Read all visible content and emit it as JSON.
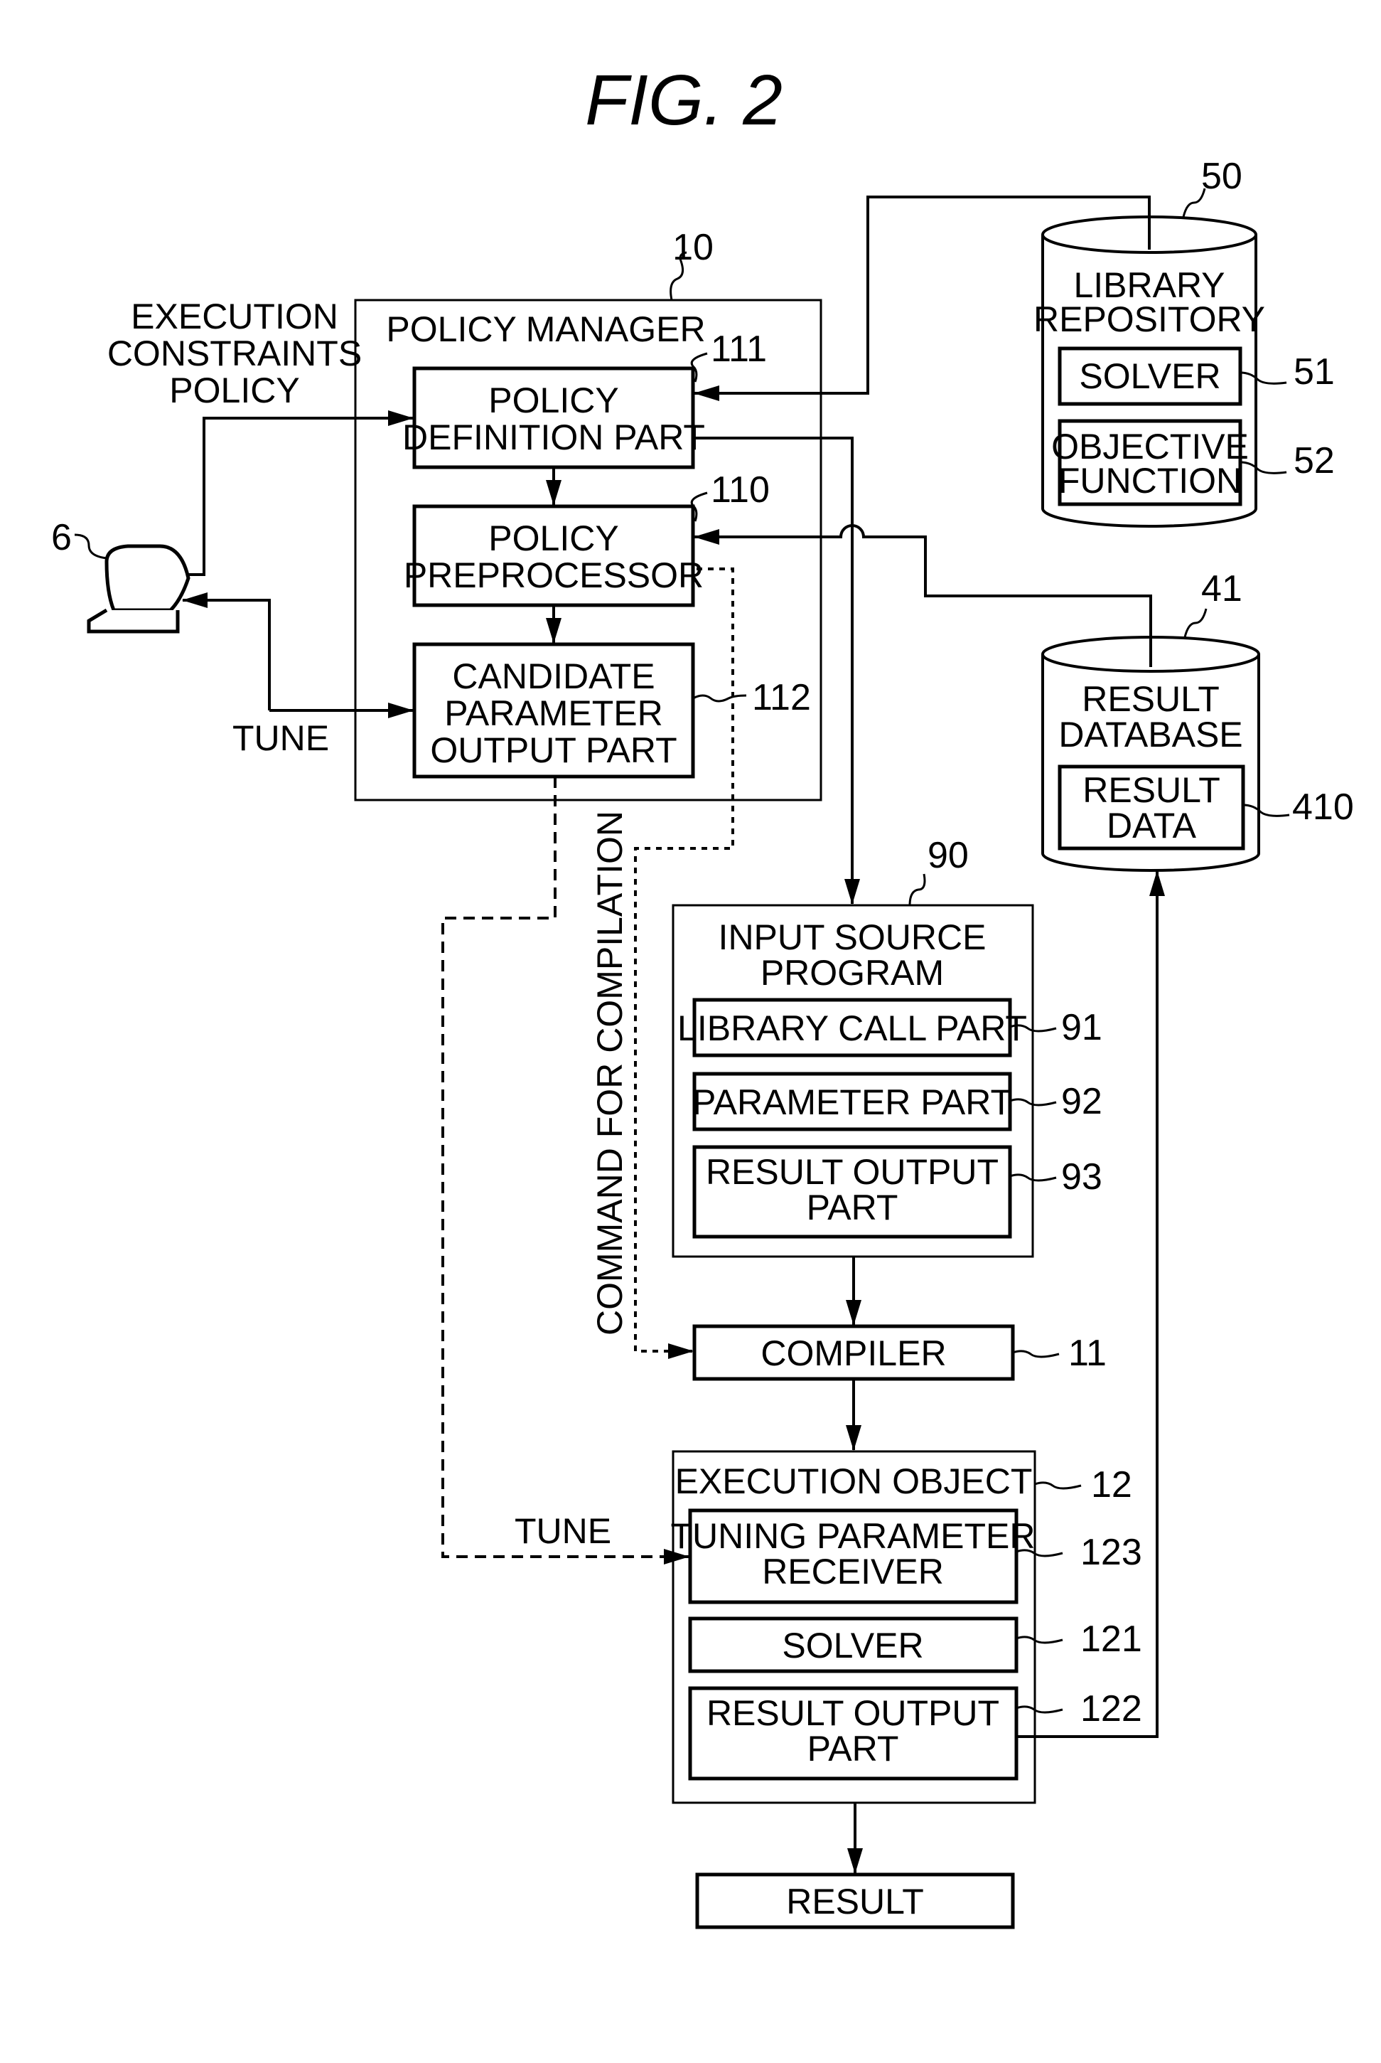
{
  "figure": {
    "title": "FIG.  2"
  },
  "policy_manager": {
    "ref": "10",
    "label": "POLICY MANAGER",
    "definition": {
      "ref": "111",
      "lines": [
        "POLICY",
        "DEFINITION PART"
      ]
    },
    "preprocessor": {
      "ref": "110",
      "lines": [
        "POLICY",
        "PREPROCESSOR"
      ]
    },
    "candidate": {
      "ref": "112",
      "lines": [
        "CANDIDATE",
        "PARAMETER",
        "OUTPUT PART"
      ]
    }
  },
  "terminal": {
    "ref": "6"
  },
  "inputs": {
    "constraints": [
      "EXECUTION",
      "CONSTRAINTS",
      "POLICY"
    ],
    "tune_top": "TUNE",
    "tune_bottom": "TUNE",
    "command": "COMMAND FOR COMPILATION"
  },
  "library_repository": {
    "ref": "50",
    "lines": [
      "LIBRARY",
      "REPOSITORY"
    ],
    "solver": {
      "ref": "51",
      "label": "SOLVER"
    },
    "objective": {
      "ref": "52",
      "lines": [
        "OBJECTIVE",
        "FUNCTION"
      ]
    }
  },
  "result_database": {
    "ref": "41",
    "lines": [
      "RESULT",
      "DATABASE"
    ],
    "data": {
      "ref": "410",
      "lines": [
        "RESULT",
        "DATA"
      ]
    }
  },
  "input_source_program": {
    "ref": "90",
    "lines": [
      "INPUT SOURCE",
      "PROGRAM"
    ],
    "library_call": {
      "ref": "91",
      "label": "LIBRARY CALL PART"
    },
    "parameter": {
      "ref": "92",
      "label": "PARAMETER PART"
    },
    "result_output": {
      "ref": "93",
      "lines": [
        "RESULT OUTPUT",
        "PART"
      ]
    }
  },
  "compiler": {
    "ref": "11",
    "label": "COMPILER"
  },
  "execution_object": {
    "ref": "12",
    "label": "EXECUTION OBJECT",
    "tuning": {
      "ref": "123",
      "lines": [
        "TUNING PARAMETER",
        "RECEIVER"
      ]
    },
    "solver": {
      "ref": "121",
      "label": "SOLVER"
    },
    "result_output": {
      "ref": "122",
      "lines": [
        "RESULT OUTPUT",
        "PART"
      ]
    }
  },
  "result": {
    "label": "RESULT"
  }
}
